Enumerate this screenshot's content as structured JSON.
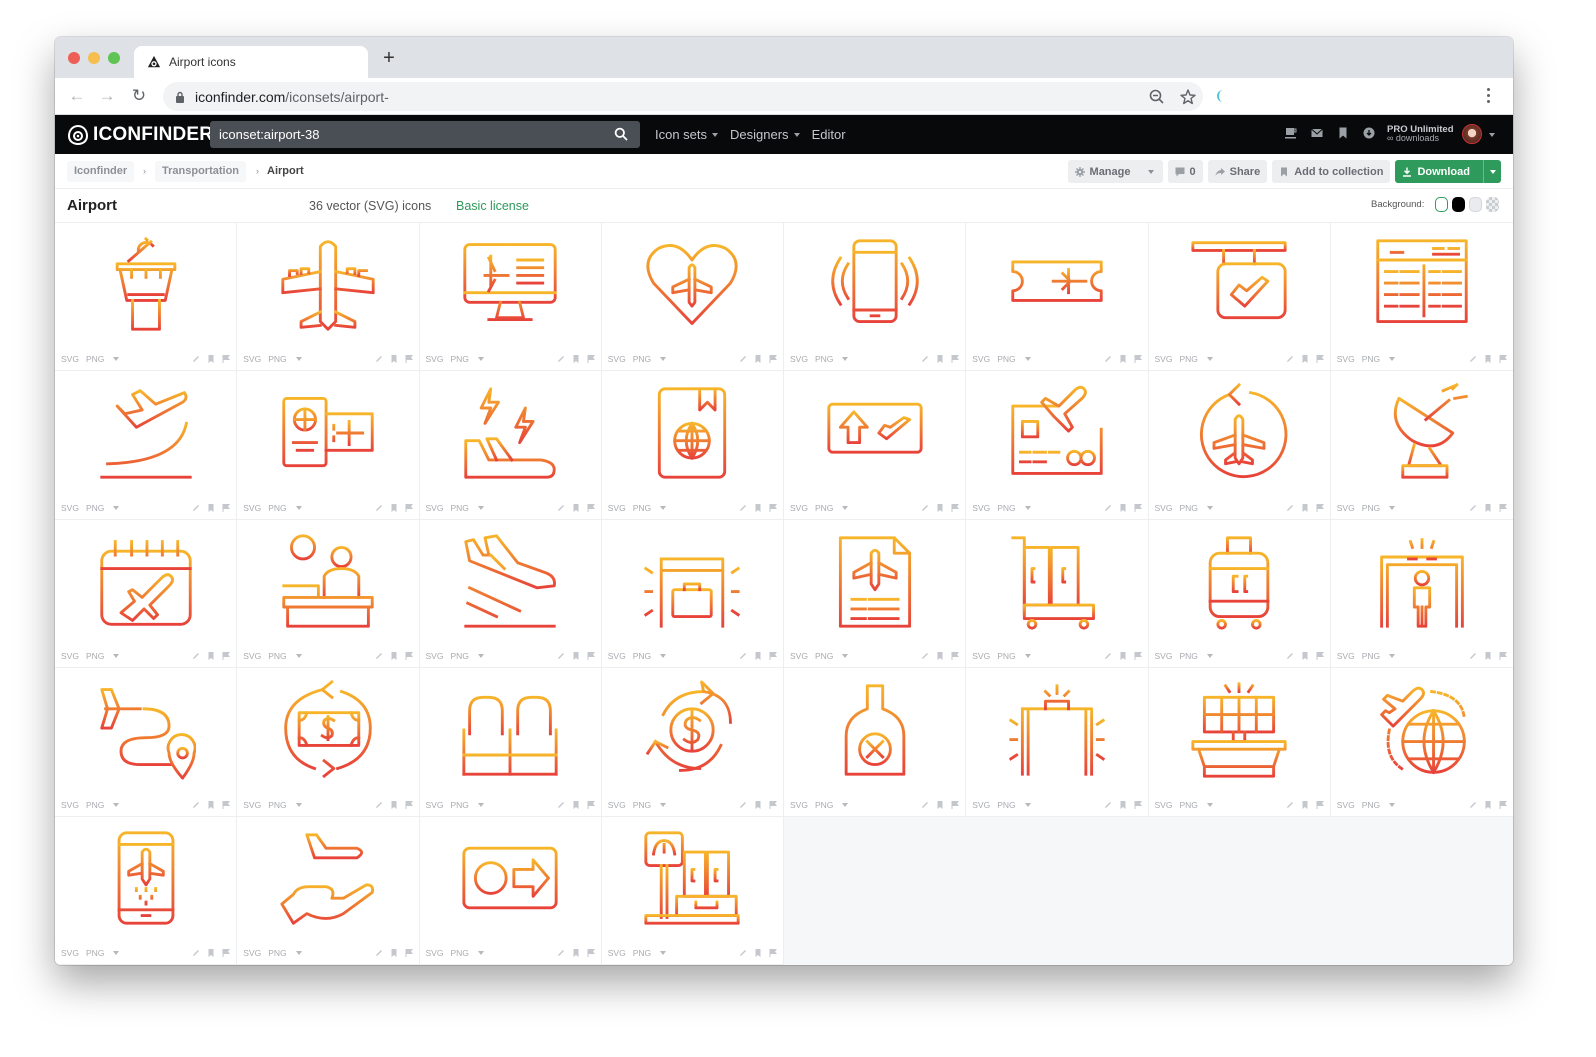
{
  "browser": {
    "tab_title": "Airport icons",
    "new_tab_label": "+",
    "url_host": "iconfinder.com",
    "url_path": "/iconsets/airport-"
  },
  "site": {
    "logo_text": "ICONFINDER",
    "search_value": "iconset:airport-38",
    "nav": [
      {
        "label": "Icon sets",
        "has_caret": true
      },
      {
        "label": "Designers",
        "has_caret": true
      },
      {
        "label": "Editor",
        "has_caret": false
      }
    ],
    "account": {
      "plan": "PRO Unlimited",
      "downloads": "∞ downloads"
    }
  },
  "breadcrumb": [
    "Iconfinder",
    "Transportation",
    "Airport"
  ],
  "actions": {
    "manage": "Manage",
    "comments": "0",
    "share": "Share",
    "add_to_collection": "Add to collection",
    "download": "Download"
  },
  "iconset": {
    "title": "Airport",
    "count_label": "36 vector (SVG) icons",
    "license": "Basic license",
    "background_label": "Background:",
    "background_options": [
      "#ffffff",
      "#000000",
      "#e4e6e9",
      "checkered"
    ],
    "selected_background": "#ffffff",
    "gradient": {
      "start": "#f7b52a",
      "end": "#e8433a"
    }
  },
  "cell_footer": {
    "svg": "SVG",
    "png": "PNG"
  },
  "icons": [
    {
      "name": "control-tower"
    },
    {
      "name": "airplane"
    },
    {
      "name": "monitor-flight"
    },
    {
      "name": "heart-airplane"
    },
    {
      "name": "smartphone-vibrate"
    },
    {
      "name": "boarding-ticket"
    },
    {
      "name": "departure-sign"
    },
    {
      "name": "flight-board"
    },
    {
      "name": "takeoff"
    },
    {
      "name": "passport-ticket"
    },
    {
      "name": "storm-flight"
    },
    {
      "name": "passport"
    },
    {
      "name": "gate-direction"
    },
    {
      "name": "credit-card-flight"
    },
    {
      "name": "return-flight"
    },
    {
      "name": "radar-dish"
    },
    {
      "name": "calendar-flight"
    },
    {
      "name": "information-desk"
    },
    {
      "name": "landing"
    },
    {
      "name": "baggage-scanner"
    },
    {
      "name": "flight-document"
    },
    {
      "name": "luggage-trolley"
    },
    {
      "name": "suitcase"
    },
    {
      "name": "security-gate"
    },
    {
      "name": "flight-route"
    },
    {
      "name": "money-exchange"
    },
    {
      "name": "waiting-seats"
    },
    {
      "name": "currency-exchange"
    },
    {
      "name": "no-liquids"
    },
    {
      "name": "metal-detector"
    },
    {
      "name": "solar-panel"
    },
    {
      "name": "international-flight"
    },
    {
      "name": "mobile-boarding"
    },
    {
      "name": "hand-airplane"
    },
    {
      "name": "info-direction"
    },
    {
      "name": "baggage-scale"
    }
  ]
}
